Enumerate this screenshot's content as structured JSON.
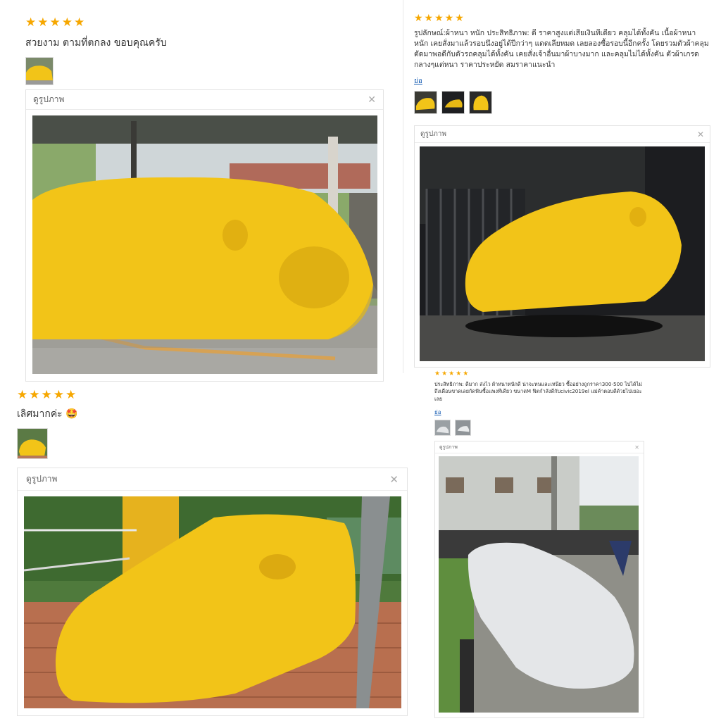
{
  "reviews": [
    {
      "stars": "★★★★★",
      "text": "สวยงาม ตามที่ตกลง ขอบคุณครับ",
      "viewer_label": "ดูรูปภาพ",
      "close": "✕"
    },
    {
      "stars": "★★★★★",
      "text": "รูปลักษณ์:ผ้าหนา หนัก ประสิทธิภาพ: ดี ราคาสูงแต่เสียเงินทีเดียว คลุมได้ทั้งคัน เนื้อผ้าหนา หนัก เคยสั่งมาแล้วรอบนึงอยู่ได้ปีกว่าๆ แดดเลียหมด เลยลองซื้อรอบนี้อีกครั้ง โดยรวมตัวผ้าคลุม ตัดมาพอดีกับตัวรถคลุมได้ทั้งคัน เคยสั่งเจ้าอื่นมาผ้าบางมาก และคลุมไม่ได้ทั้งคัน ตัวผ้าเกรดกลางๆแต่หนา ราคาประหยัด สมราคาแนะนำ",
      "more": "ย่อ",
      "viewer_label": "ดูรูปภาพ",
      "close": "✕"
    },
    {
      "stars": "★★★★★",
      "text": "เลิศมากค่ะ 🤩",
      "viewer_label": "ดูรูปภาพ",
      "close": "✕"
    },
    {
      "stars": "★★★★★",
      "text": "ประสิทธิภาพ: ดีมาก ส่งไว ผ้าหนาหนักดี น่าจะทนและเหนียว ซื้ออย่างถูกราคา300-500 ไปได้ไม่ถึงเดือนขาดเลยกัดฟันซื้อแพงทีเดียว ขนาดM ฟิตกำลังดีกับcivic2019el แม่ค้าตอบดีด้วยไปเยอะเลย",
      "more": "ย่อ",
      "viewer_label": "ดูรูปภาพ",
      "close": "✕"
    }
  ],
  "colors": {
    "star": "#f6a700",
    "link": "#1a5fb4",
    "cover_yellow": "#f2c418",
    "cover_silver": "#d9dcdf"
  }
}
